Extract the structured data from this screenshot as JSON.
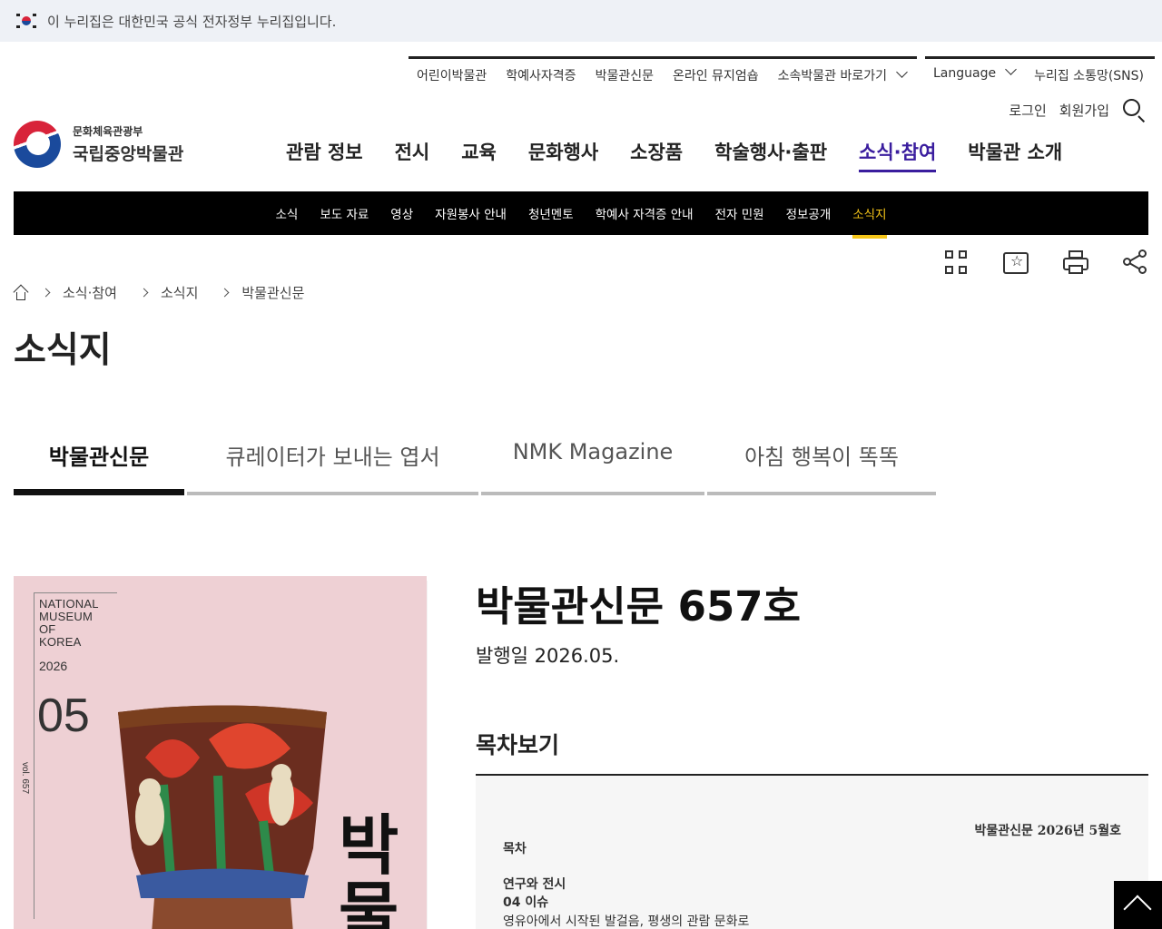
{
  "gov_banner": {
    "text": "이 누리집은 대한민국 공식 전자정부 누리집입니다."
  },
  "utility_nav": {
    "items": [
      "어린이박물관",
      "학예사자격증",
      "박물관신문",
      "온라인 뮤지엄숍",
      "소속박물관 바로가기"
    ],
    "language": "Language",
    "sns": "누리집 소통망(SNS)",
    "login": "로그인",
    "signup": "회원가입"
  },
  "logo": {
    "sub": "문화체육관광부",
    "main": "국립중앙박물관"
  },
  "main_nav": {
    "items": [
      "관람 정보",
      "전시",
      "교육",
      "문화행사",
      "소장품",
      "학술행사·출판",
      "소식·참여",
      "박물관 소개"
    ],
    "active": "소식·참여"
  },
  "sub_nav": {
    "items": [
      "소식",
      "보도 자료",
      "영상",
      "자원봉사 안내",
      "청년멘토",
      "학예사 자격증 안내",
      "전자 민원",
      "정보공개",
      "소식지"
    ],
    "active": "소식지"
  },
  "tools": [
    "qr-code-icon",
    "bookmark-star-icon",
    "print-icon",
    "share-icon"
  ],
  "breadcrumb": [
    "소식·참여",
    "소식지",
    "박물관신문"
  ],
  "page_title": "소식지",
  "tabs": [
    "박물관신문",
    "큐레이터가 보내는 엽서",
    "NMK Magazine",
    "아침 행복이 똑똑"
  ],
  "active_tab": "박물관신문",
  "cover": {
    "brand": [
      "NATIONAL",
      "MUSEUM",
      "OF",
      "KOREA"
    ],
    "year": "2026",
    "month": "05",
    "vol": "vol. 657",
    "title": "박물"
  },
  "issue": {
    "title": "박물관신문 657호",
    "date": "발행일 2026.05."
  },
  "toc": {
    "heading": "목차보기",
    "edition": "박물관신문 2026년 5월호",
    "label": "목차",
    "section": "연구와 전시",
    "subsection": "04 이슈",
    "article": "영유아에서 시작된 발걸음, 평생의 관람 문화로"
  },
  "colors": {
    "accent": "#3a1d9e",
    "subnav_active": "#f5c518",
    "cover_bg": "#eed0d4"
  }
}
